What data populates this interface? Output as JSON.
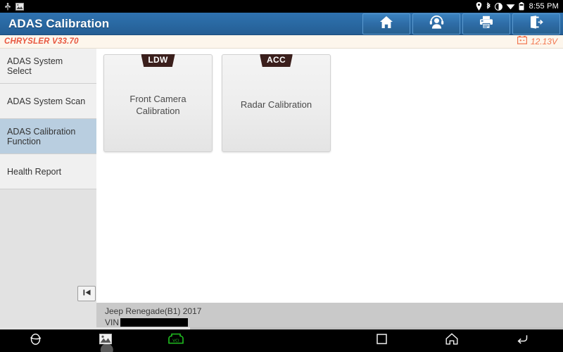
{
  "status_bar": {
    "left_icons": [
      "usb-icon",
      "screenshot-image-icon"
    ],
    "right_icons": [
      "location-pin-icon",
      "bluetooth-icon",
      "brightness-contrast-icon",
      "wifi-icon",
      "battery-icon"
    ],
    "time": "8:55 PM"
  },
  "header": {
    "title": "ADAS Calibration",
    "buttons": [
      {
        "name": "home-button",
        "icon": "home-icon"
      },
      {
        "name": "support-button",
        "icon": "headset-person-icon"
      },
      {
        "name": "print-button",
        "icon": "printer-icon"
      },
      {
        "name": "exit-button",
        "icon": "exit-door-icon"
      }
    ]
  },
  "version_bar": {
    "vehicle_version": "CHRYSLER V33.70",
    "battery_icon": "car-battery-icon",
    "voltage": "12.13V",
    "voltage_color": "#f2764f",
    "version_color": "#e8573f"
  },
  "sidebar": {
    "items": [
      {
        "label": "ADAS System Select",
        "selected": false
      },
      {
        "label": "ADAS System Scan",
        "selected": false
      },
      {
        "label": "ADAS Calibration Function",
        "selected": true
      },
      {
        "label": "Health Report",
        "selected": false
      }
    ],
    "selected_color": "#b9cee0",
    "collapse_button": {
      "name": "collapse-sidebar-button",
      "icon": "skip-to-start-icon"
    }
  },
  "main": {
    "cards": [
      {
        "badge": "LDW",
        "label": "Front Camera Calibration"
      },
      {
        "badge": "ACC",
        "label": "Radar Calibration"
      }
    ],
    "badge_color": "#3b1f1c"
  },
  "vehicle_info": {
    "name": "Jeep Renegade(B1) 2017",
    "vin_label": "VIN",
    "vin_value": ""
  },
  "nav_bar": {
    "left_items": [
      {
        "name": "browser-icon"
      },
      {
        "name": "gallery-image-icon"
      },
      {
        "name": "vci-connector-icon",
        "label": "VCI",
        "color": "#20c020"
      }
    ],
    "right_items": [
      {
        "name": "recent-apps-icon"
      },
      {
        "name": "home-icon"
      },
      {
        "name": "back-icon"
      }
    ]
  }
}
